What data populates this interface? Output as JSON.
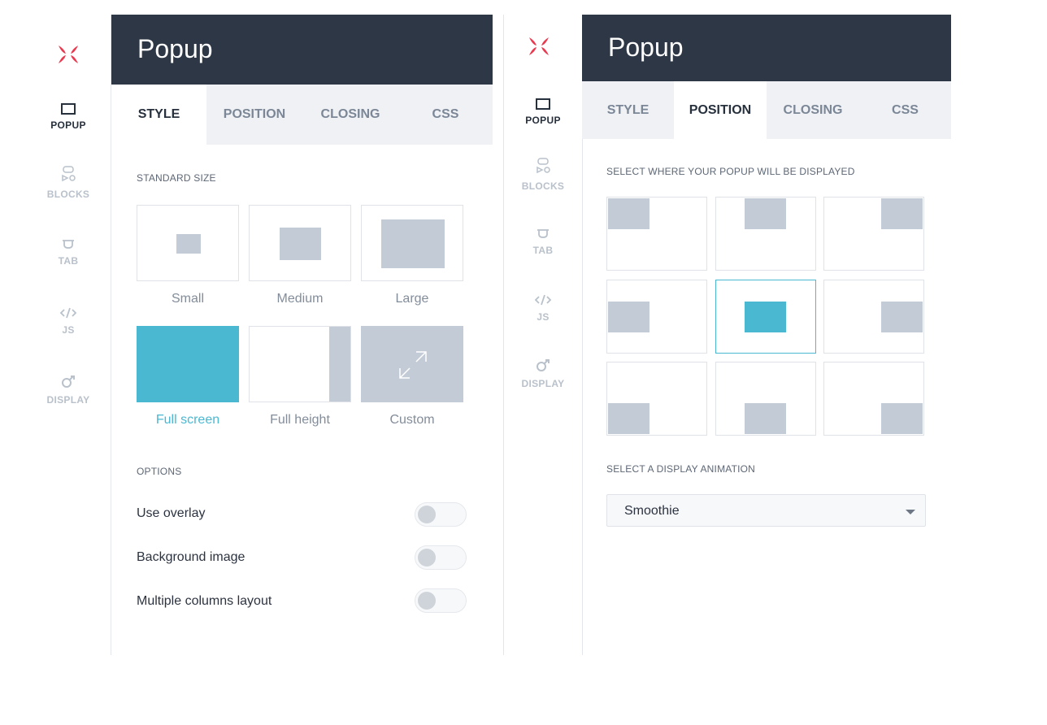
{
  "colors": {
    "header_bg": "#2d3745",
    "accent": "#4bb8d2",
    "logo": "#e8394f",
    "placeholder_shape": "#c3ccd6"
  },
  "sidebar": {
    "items": [
      {
        "label": "POPUP",
        "icon": "popup-icon"
      },
      {
        "label": "BLOCKS",
        "icon": "blocks-icon"
      },
      {
        "label": "TAB",
        "icon": "tab-icon"
      },
      {
        "label": "JS",
        "icon": "code-icon"
      },
      {
        "label": "DISPLAY",
        "icon": "display-icon"
      }
    ]
  },
  "left_panel": {
    "title": "Popup",
    "tabs": [
      "STYLE",
      "POSITION",
      "CLOSING",
      "CSS"
    ],
    "active_tab": "STYLE",
    "standard_size_label": "STANDARD SIZE",
    "sizes": [
      "Small",
      "Medium",
      "Large",
      "Full screen",
      "Full height",
      "Custom"
    ],
    "selected_size": "Full screen",
    "options_label": "OPTIONS",
    "options": [
      {
        "label": "Use overlay",
        "enabled": false
      },
      {
        "label": "Background image",
        "enabled": false
      },
      {
        "label": "Multiple columns layout",
        "enabled": false
      }
    ]
  },
  "right_panel": {
    "title": "Popup",
    "tabs": [
      "STYLE",
      "POSITION",
      "CLOSING",
      "CSS"
    ],
    "active_tab": "POSITION",
    "position_label": "SELECT WHERE YOUR POPUP WILL BE DISPLAYED",
    "positions": [
      "top-left",
      "top-center",
      "top-right",
      "middle-left",
      "center",
      "middle-right",
      "bottom-left",
      "bottom-center",
      "bottom-right"
    ],
    "selected_position": "center",
    "animation_label": "SELECT A DISPLAY ANIMATION",
    "animation_value": "Smoothie"
  }
}
